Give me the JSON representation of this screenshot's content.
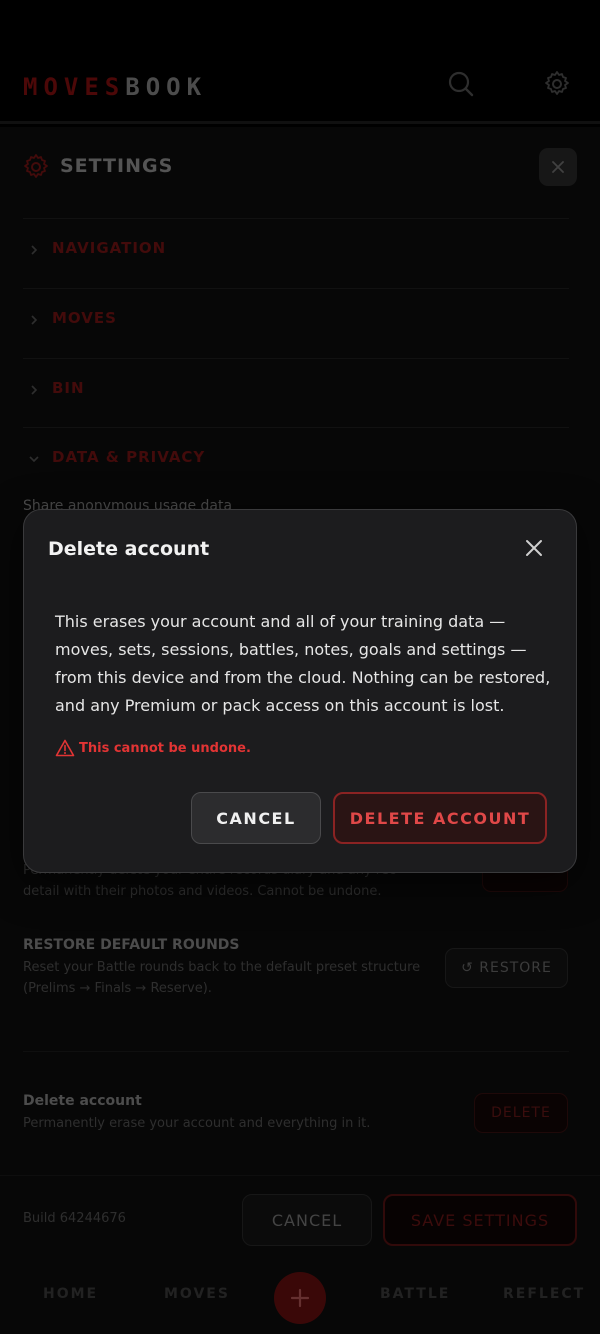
{
  "header": {
    "logo_part1": "MOVES",
    "logo_part2": "BOOK",
    "search_icon": "search-icon",
    "settings_icon": "gear-icon"
  },
  "settings": {
    "title": "SETTINGS",
    "sections": [
      {
        "label": "NAVIGATION",
        "expanded": false
      },
      {
        "label": "MOVES",
        "expanded": false
      },
      {
        "label": "BIN",
        "expanded": false
      },
      {
        "label": "DATA & PRIVACY",
        "expanded": true
      }
    ],
    "share_usage_title": "Share anonymous usage data",
    "clear_desc": "Permanently delete your entire records diary and any rec detail with their photos and videos. Cannot be undone.",
    "restore": {
      "title": "RESTORE DEFAULT ROUNDS",
      "desc": "Reset your Battle rounds back to the default preset structure (Prelims → Finals → Reserve).",
      "button": "↺ RESTORE"
    },
    "delete_account": {
      "title": "Delete account",
      "desc": "Permanently erase your account and everything in it.",
      "button": "DELETE"
    },
    "footer": {
      "build": "Build 64244676",
      "cancel": "CANCEL",
      "save": "SAVE SETTINGS"
    }
  },
  "bottom_nav": {
    "items": [
      "HOME",
      "MOVES",
      "BATTLE",
      "REFLECT"
    ],
    "fab": "+"
  },
  "modal": {
    "title": "Delete account",
    "body": "This erases your account and all of your training data — moves, sets, sessions, battles, notes, goals and settings — from this device and from the cloud. Nothing can be restored, and any Premium or pack access on this account is lost.",
    "warning": "This cannot be undone.",
    "cancel": "CANCEL",
    "confirm": "DELETE ACCOUNT"
  },
  "colors": {
    "accent_red": "#e04848",
    "brand_dark_red": "#8a0f0f",
    "background": "#000000",
    "modal_bg": "#1c1c1e"
  }
}
